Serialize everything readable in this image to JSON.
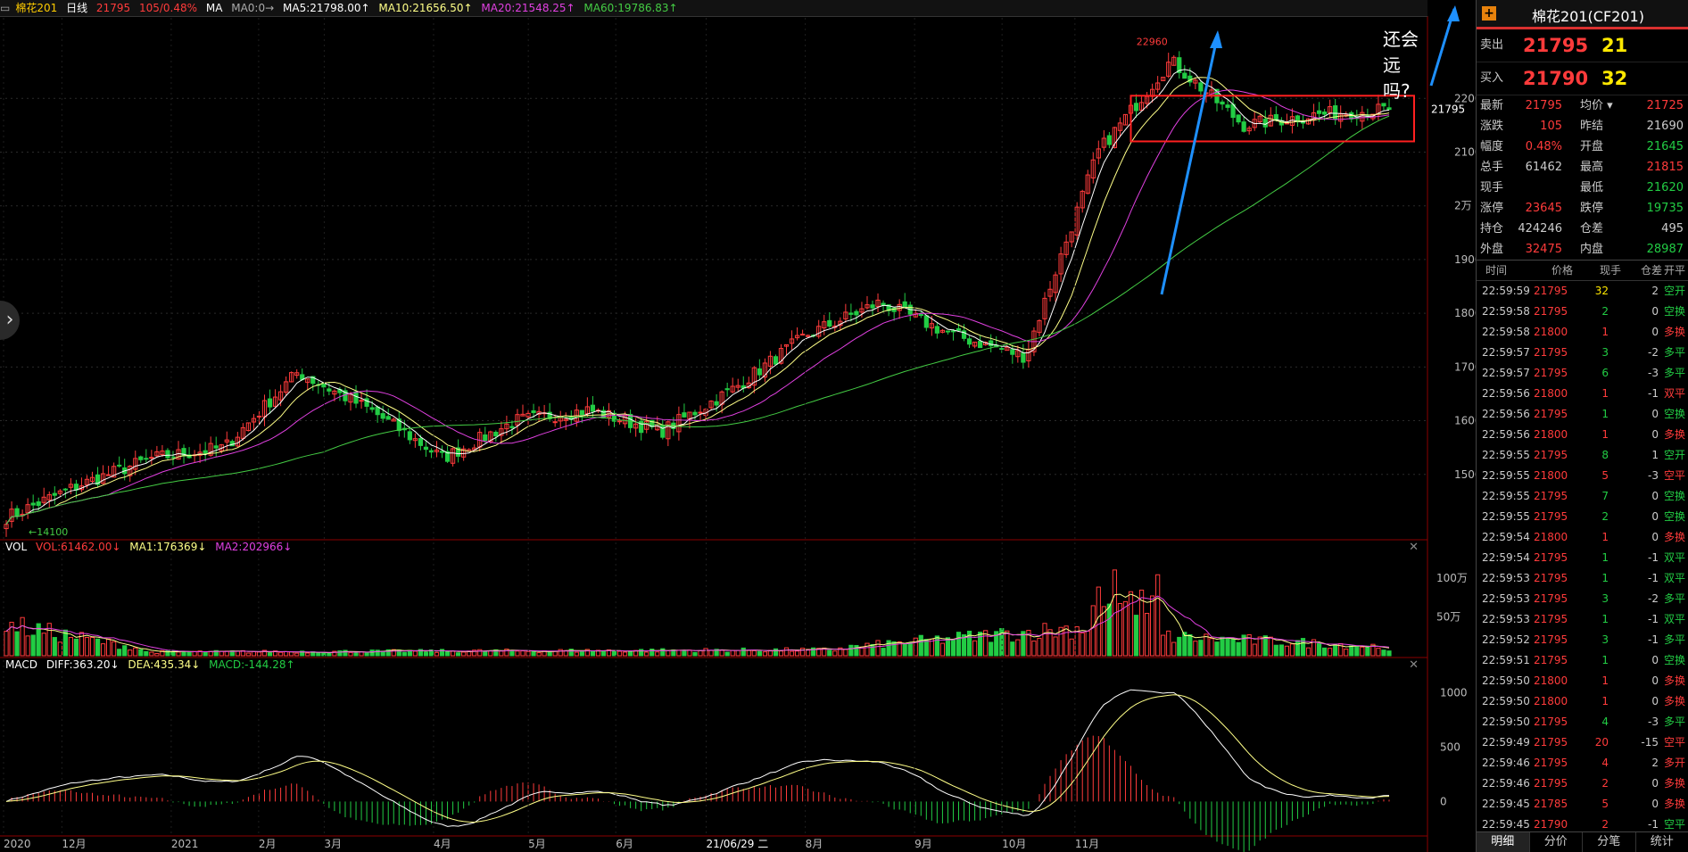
{
  "header": {
    "symbol": "棉花201",
    "period": "日线",
    "last": "21795",
    "chg": "105/0.48%",
    "ma_label": "MA",
    "ma0": "MA0:0→",
    "ma5": "MA5:21798.00↑",
    "ma10": "MA10:21656.50↑",
    "ma20": "MA20:21548.25↑",
    "ma60": "MA60:19786.83↑"
  },
  "colors": {
    "up": "#ff3b3b",
    "down": "#22cc44",
    "ma5": "#ffffff",
    "ma10": "#ffff88",
    "ma20": "#e040e0",
    "ma60": "#44cc44",
    "arrow": "#1e90ff",
    "box": "#ff2020"
  },
  "annotation": "还会远吗?",
  "price_pane": {
    "high_label": "22960",
    "low_label": "14100",
    "current_label": "21795",
    "yticks": [
      "22000",
      "21000",
      "2万",
      "19000",
      "18000",
      "17000",
      "16000",
      "15000"
    ]
  },
  "vol_pane": {
    "title": "VOL",
    "vol": "VOL:61462.00↓",
    "ma1": "MA1:176369↓",
    "ma2": "MA2:202966↓",
    "yticks": [
      "100万",
      "50万"
    ]
  },
  "macd_pane": {
    "title": "MACD",
    "diff": "DIFF:363.20↓",
    "dea": "DEA:435.34↓",
    "macd": "MACD:-144.28↑",
    "yticks": [
      "1000",
      "500",
      "0"
    ]
  },
  "xaxis": {
    "labels": [
      "2020",
      "12月",
      "2021",
      "2月",
      "3月",
      "4月",
      "5月",
      "6月",
      "21/06/29 二",
      "8月",
      "9月",
      "10月",
      "11月"
    ]
  },
  "chart_data": {
    "type": "candlestick",
    "title": "棉花201(CF201)",
    "ylim": [
      13800,
      23500
    ],
    "series_anchors": [
      {
        "date": "2020-11",
        "close": 14200
      },
      {
        "date": "2020-12",
        "close": 14800
      },
      {
        "date": "2021-01",
        "close": 15300
      },
      {
        "date": "2021-02",
        "close": 15500
      },
      {
        "date": "2021-02-25",
        "close": 16900
      },
      {
        "date": "2021-03",
        "close": 16200
      },
      {
        "date": "2021-04",
        "close": 15300
      },
      {
        "date": "2021-05",
        "close": 16000
      },
      {
        "date": "2021-05-20",
        "close": 16200
      },
      {
        "date": "2021-06",
        "close": 15800
      },
      {
        "date": "2021-07",
        "close": 16600
      },
      {
        "date": "2021-08",
        "close": 17600
      },
      {
        "date": "2021-08-15",
        "close": 18200
      },
      {
        "date": "2021-09",
        "close": 17600
      },
      {
        "date": "2021-09-25",
        "close": 17200
      },
      {
        "date": "2021-10",
        "close": 21000
      },
      {
        "date": "2021-10-12",
        "close": 22700
      },
      {
        "date": "2021-10-20",
        "close": 21500
      },
      {
        "date": "2021-11",
        "close": 21700
      },
      {
        "date": "2021-11-25",
        "close": 21795
      }
    ],
    "ma60_end": 19786.83
  },
  "right_panel": {
    "title": "棉花201(CF201)",
    "ask": {
      "label": "卖出",
      "price": "21795",
      "qty": "21"
    },
    "bid": {
      "label": "买入",
      "price": "21790",
      "qty": "32"
    },
    "quote": [
      {
        "l1": "最新",
        "v1": "21795",
        "l2": "均价 ▾",
        "v2": "21725",
        "c1": "#ff3b3b",
        "c2": "#ff3b3b"
      },
      {
        "l1": "涨跌",
        "v1": "105",
        "l2": "昨结",
        "v2": "21690",
        "c1": "#ff3b3b",
        "c2": "#ccc"
      },
      {
        "l1": "幅度",
        "v1": "0.48%",
        "l2": "开盘",
        "v2": "21645",
        "c1": "#ff3b3b",
        "c2": "#22cc44"
      },
      {
        "l1": "总手",
        "v1": "61462",
        "l2": "最高",
        "v2": "21815",
        "c1": "#ccc",
        "c2": "#ff3b3b"
      },
      {
        "l1": "现手",
        "v1": "",
        "l2": "最低",
        "v2": "21620",
        "c1": "#ccc",
        "c2": "#22cc44"
      },
      {
        "l1": "涨停",
        "v1": "23645",
        "l2": "跌停",
        "v2": "19735",
        "c1": "#ff3b3b",
        "c2": "#22cc44"
      },
      {
        "l1": "持仓",
        "v1": "424246",
        "l2": "仓差",
        "v2": "495",
        "c1": "#ccc",
        "c2": "#ccc"
      },
      {
        "l1": "外盘",
        "v1": "32475",
        "l2": "内盘",
        "v2": "28987",
        "c1": "#ff3b3b",
        "c2": "#22cc44"
      }
    ],
    "tick_headers": [
      "时间",
      "价格",
      "现手",
      "仓差",
      "开平"
    ],
    "ticks": [
      {
        "t": "22:59:59",
        "p": "21795",
        "q": "32",
        "d": "2",
        "k": "空开",
        "qc": "#ffe800",
        "kc": "#22cc44"
      },
      {
        "t": "22:59:58",
        "p": "21795",
        "q": "2",
        "d": "0",
        "k": "空换",
        "qc": "#22cc44",
        "kc": "#22cc44"
      },
      {
        "t": "22:59:58",
        "p": "21800",
        "q": "1",
        "d": "0",
        "k": "多换",
        "qc": "#ff3b3b",
        "kc": "#ff3b3b"
      },
      {
        "t": "22:59:57",
        "p": "21795",
        "q": "3",
        "d": "-2",
        "k": "多平",
        "qc": "#22cc44",
        "kc": "#22cc44"
      },
      {
        "t": "22:59:57",
        "p": "21795",
        "q": "6",
        "d": "-3",
        "k": "多平",
        "qc": "#22cc44",
        "kc": "#22cc44"
      },
      {
        "t": "22:59:56",
        "p": "21800",
        "q": "1",
        "d": "-1",
        "k": "双平",
        "qc": "#ff3b3b",
        "kc": "#ff3b3b"
      },
      {
        "t": "22:59:56",
        "p": "21795",
        "q": "1",
        "d": "0",
        "k": "空换",
        "qc": "#22cc44",
        "kc": "#22cc44"
      },
      {
        "t": "22:59:56",
        "p": "21800",
        "q": "1",
        "d": "0",
        "k": "多换",
        "qc": "#ff3b3b",
        "kc": "#ff3b3b"
      },
      {
        "t": "22:59:55",
        "p": "21795",
        "q": "8",
        "d": "1",
        "k": "空开",
        "qc": "#22cc44",
        "kc": "#22cc44"
      },
      {
        "t": "22:59:55",
        "p": "21800",
        "q": "5",
        "d": "-3",
        "k": "空平",
        "qc": "#ff3b3b",
        "kc": "#ff3b3b"
      },
      {
        "t": "22:59:55",
        "p": "21795",
        "q": "7",
        "d": "0",
        "k": "空换",
        "qc": "#22cc44",
        "kc": "#22cc44"
      },
      {
        "t": "22:59:55",
        "p": "21795",
        "q": "2",
        "d": "0",
        "k": "空换",
        "qc": "#22cc44",
        "kc": "#22cc44"
      },
      {
        "t": "22:59:54",
        "p": "21800",
        "q": "1",
        "d": "0",
        "k": "多换",
        "qc": "#ff3b3b",
        "kc": "#ff3b3b"
      },
      {
        "t": "22:59:54",
        "p": "21795",
        "q": "1",
        "d": "-1",
        "k": "双平",
        "qc": "#22cc44",
        "kc": "#22cc44"
      },
      {
        "t": "22:59:53",
        "p": "21795",
        "q": "1",
        "d": "-1",
        "k": "双平",
        "qc": "#22cc44",
        "kc": "#22cc44"
      },
      {
        "t": "22:59:53",
        "p": "21795",
        "q": "3",
        "d": "-2",
        "k": "多平",
        "qc": "#22cc44",
        "kc": "#22cc44"
      },
      {
        "t": "22:59:53",
        "p": "21795",
        "q": "1",
        "d": "-1",
        "k": "双平",
        "qc": "#22cc44",
        "kc": "#22cc44"
      },
      {
        "t": "22:59:52",
        "p": "21795",
        "q": "3",
        "d": "-1",
        "k": "多平",
        "qc": "#22cc44",
        "kc": "#22cc44"
      },
      {
        "t": "22:59:51",
        "p": "21795",
        "q": "1",
        "d": "0",
        "k": "空换",
        "qc": "#22cc44",
        "kc": "#22cc44"
      },
      {
        "t": "22:59:50",
        "p": "21800",
        "q": "1",
        "d": "0",
        "k": "多换",
        "qc": "#ff3b3b",
        "kc": "#ff3b3b"
      },
      {
        "t": "22:59:50",
        "p": "21800",
        "q": "1",
        "d": "0",
        "k": "多换",
        "qc": "#ff3b3b",
        "kc": "#ff3b3b"
      },
      {
        "t": "22:59:50",
        "p": "21795",
        "q": "4",
        "d": "-3",
        "k": "多平",
        "qc": "#22cc44",
        "kc": "#22cc44"
      },
      {
        "t": "22:59:49",
        "p": "21795",
        "q": "20",
        "d": "-15",
        "k": "空平",
        "qc": "#ff3b3b",
        "kc": "#ff3b3b"
      },
      {
        "t": "22:59:46",
        "p": "21795",
        "q": "4",
        "d": "2",
        "k": "多开",
        "qc": "#ff3b3b",
        "kc": "#ff3b3b"
      },
      {
        "t": "22:59:46",
        "p": "21795",
        "q": "2",
        "d": "0",
        "k": "多换",
        "qc": "#ff3b3b",
        "kc": "#ff3b3b"
      },
      {
        "t": "22:59:45",
        "p": "21785",
        "q": "5",
        "d": "0",
        "k": "多换",
        "qc": "#ff3b3b",
        "kc": "#ff3b3b"
      },
      {
        "t": "22:59:45",
        "p": "21790",
        "q": "2",
        "d": "-1",
        "k": "空平",
        "qc": "#ff3b3b",
        "kc": "#22cc44"
      }
    ],
    "tabs": [
      "明细",
      "分价",
      "分笔",
      "统计"
    ]
  }
}
